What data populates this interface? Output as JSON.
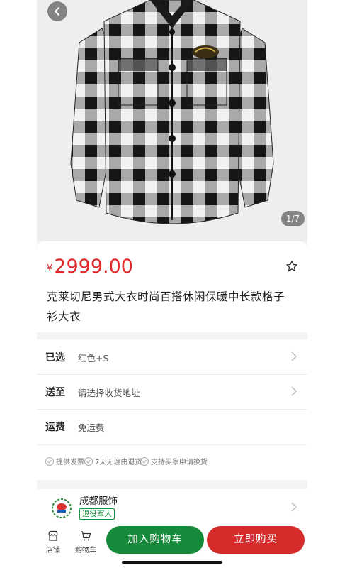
{
  "gallery": {
    "counter": "1/7"
  },
  "product": {
    "currency": "¥",
    "price": "2999.00",
    "title": "克莱切尼男式大衣时尚百搭休闲保暖中长款格子衫大衣"
  },
  "specs": [
    {
      "label": "已选",
      "value": "红色+S"
    },
    {
      "label": "送至",
      "value": "请选择收货地址"
    },
    {
      "label": "运费",
      "value": "免运费"
    }
  ],
  "guarantees": [
    "提供发票",
    "7天无理由退货",
    "支持买家申请换货"
  ],
  "shop": {
    "name": "成都服饰",
    "tag": "退役军人"
  },
  "bottom_bar": {
    "store_label": "店铺",
    "cart_label": "购物车",
    "add_to_cart": "加入购物车",
    "buy_now": "立即购买"
  },
  "colors": {
    "price_red": "#e0292a",
    "cart_green": "#168a3a",
    "buy_red": "#d52b2b"
  },
  "icons": [
    "back-arrow-icon",
    "star-outline-icon",
    "chevron-right-icon",
    "check-circle-icon",
    "store-icon",
    "cart-icon",
    "shop-logo-icon"
  ]
}
